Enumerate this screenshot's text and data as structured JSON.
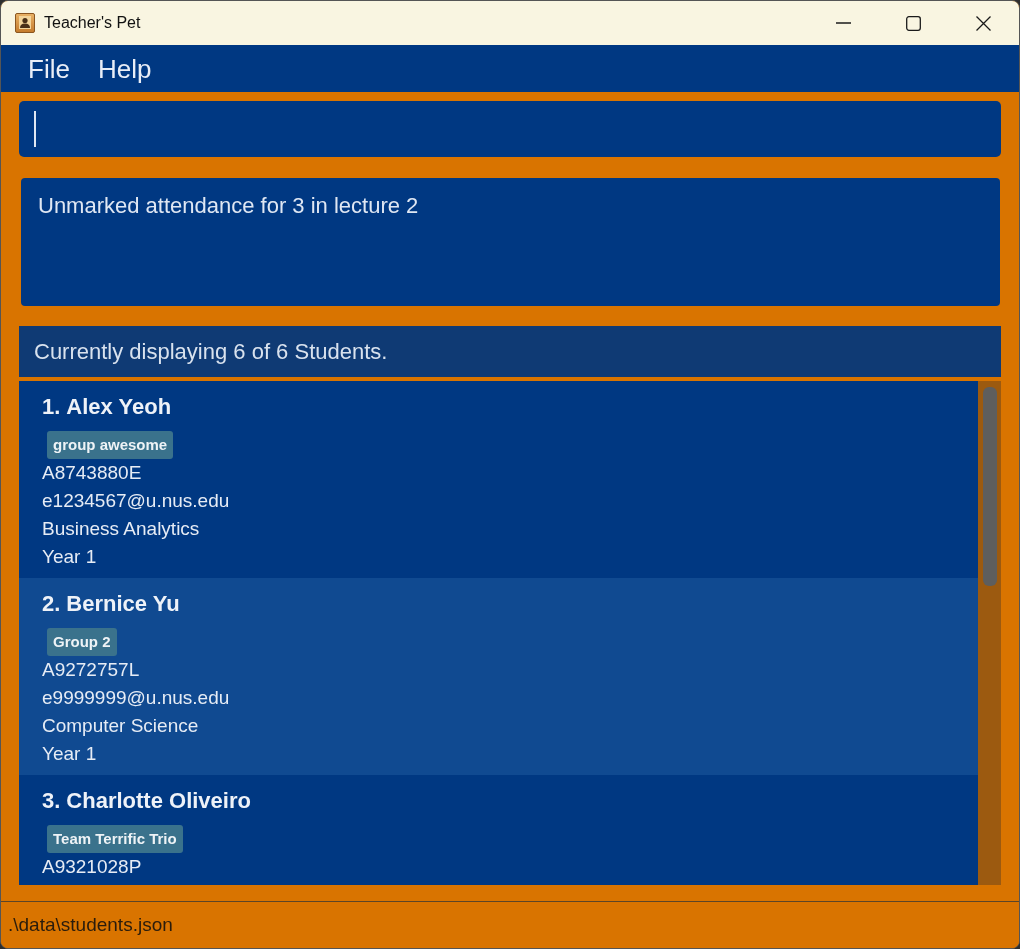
{
  "window": {
    "title": "Teacher's Pet"
  },
  "menu": [
    "File",
    "Help"
  ],
  "command_box": {
    "focused": true
  },
  "result_display": {
    "text": "Unmarked attendance for 3 in lecture 2"
  },
  "student_list": {
    "header": "Currently displaying 6 of 6 Students.",
    "students": [
      {
        "index": "1.",
        "name": "Alex Yeoh",
        "tags": [
          "group awesome"
        ],
        "student_id": "A8743880E",
        "email": "e1234567@u.nus.edu",
        "major": "Business Analytics",
        "year": "Year 1"
      },
      {
        "index": "2.",
        "name": "Bernice Yu",
        "tags": [
          "Group 2"
        ],
        "student_id": "A9272757L",
        "email": "e9999999@u.nus.edu",
        "major": "Computer Science",
        "year": "Year 1"
      },
      {
        "index": "3.",
        "name": "Charlotte Oliveiro",
        "tags": [
          "Team Terrific Trio"
        ],
        "student_id": "A9321028P"
      }
    ]
  },
  "status_bar": {
    "path": ".\\data\\students.json"
  }
}
